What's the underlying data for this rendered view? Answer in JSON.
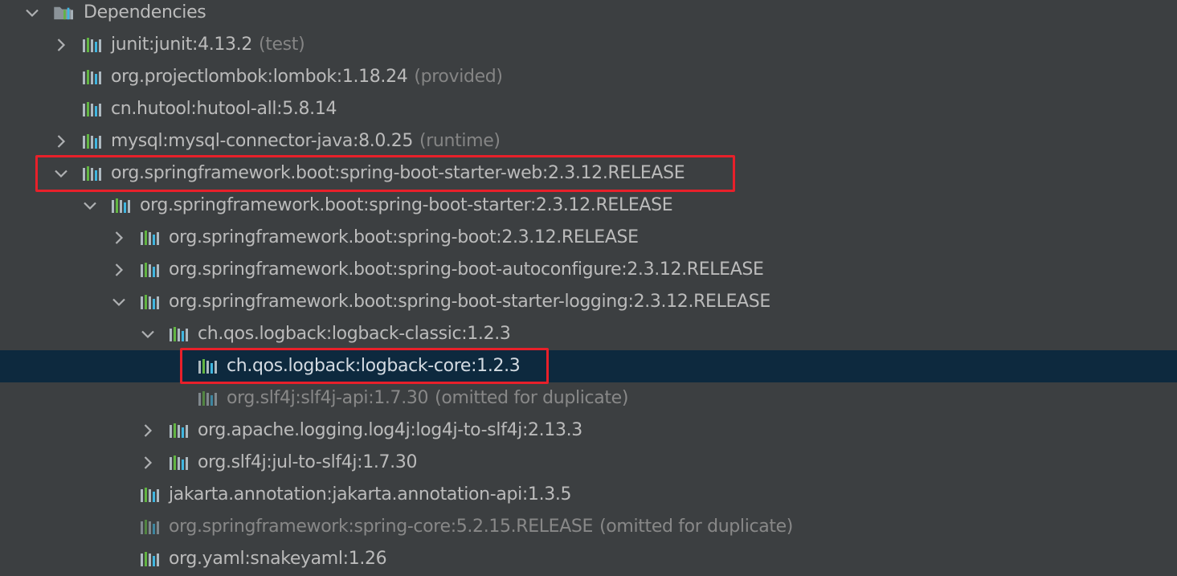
{
  "tree": {
    "root": {
      "label": "Dependencies",
      "icon": "folder-chart-icon",
      "expanded": true
    },
    "rows": [
      {
        "label": "junit:junit:4.13.2",
        "scope": "(test)",
        "icon": "library-icon",
        "expander": "collapsed"
      },
      {
        "label": "org.projectlombok:lombok:1.18.24",
        "scope": "(provided)",
        "icon": "library-icon",
        "expander": "none"
      },
      {
        "label": "cn.hutool:hutool-all:5.8.14",
        "scope": "",
        "icon": "library-icon",
        "expander": "none"
      },
      {
        "label": "mysql:mysql-connector-java:8.0.25",
        "scope": "(runtime)",
        "icon": "library-icon",
        "expander": "collapsed"
      },
      {
        "label": "org.springframework.boot:spring-boot-starter-web:2.3.12.RELEASE",
        "scope": "",
        "icon": "library-icon",
        "expander": "expanded",
        "highlighted": true
      },
      {
        "label": "org.springframework.boot:spring-boot-starter:2.3.12.RELEASE",
        "scope": "",
        "icon": "library-icon",
        "expander": "expanded"
      },
      {
        "label": "org.springframework.boot:spring-boot:2.3.12.RELEASE",
        "scope": "",
        "icon": "library-icon",
        "expander": "collapsed"
      },
      {
        "label": "org.springframework.boot:spring-boot-autoconfigure:2.3.12.RELEASE",
        "scope": "",
        "icon": "library-icon",
        "expander": "collapsed"
      },
      {
        "label": "org.springframework.boot:spring-boot-starter-logging:2.3.12.RELEASE",
        "scope": "",
        "icon": "library-icon",
        "expander": "expanded"
      },
      {
        "label": "ch.qos.logback:logback-classic:1.2.3",
        "scope": "",
        "icon": "library-icon",
        "expander": "expanded"
      },
      {
        "label": "ch.qos.logback:logback-core:1.2.3",
        "scope": "",
        "icon": "library-icon",
        "expander": "none",
        "selected": true,
        "highlighted": true
      },
      {
        "label": "org.slf4j:slf4j-api:1.7.30",
        "scope": "(omitted for duplicate)",
        "icon": "library-icon",
        "expander": "none",
        "omitted": true
      },
      {
        "label": "org.apache.logging.log4j:log4j-to-slf4j:2.13.3",
        "scope": "",
        "icon": "library-icon",
        "expander": "collapsed"
      },
      {
        "label": "org.slf4j:jul-to-slf4j:1.7.30",
        "scope": "",
        "icon": "library-icon",
        "expander": "collapsed"
      },
      {
        "label": "jakarta.annotation:jakarta.annotation-api:1.3.5",
        "scope": "",
        "icon": "library-icon",
        "expander": "none"
      },
      {
        "label": "org.springframework:spring-core:5.2.15.RELEASE",
        "scope": "(omitted for duplicate)",
        "icon": "library-icon",
        "expander": "none",
        "omitted": true
      },
      {
        "label": "org.yaml:snakeyaml:1.26",
        "scope": "",
        "icon": "library-icon",
        "expander": "none"
      }
    ]
  },
  "colors": {
    "background": "#3c3f41",
    "selection": "#0d293e",
    "text": "#bbbbbb",
    "scope_text": "#858585",
    "omitted_text": "#888888",
    "highlight_border": "#e8202a",
    "icon_green": "#62b543",
    "icon_blue": "#40b6e0",
    "icon_gray": "#aeb9c0"
  }
}
